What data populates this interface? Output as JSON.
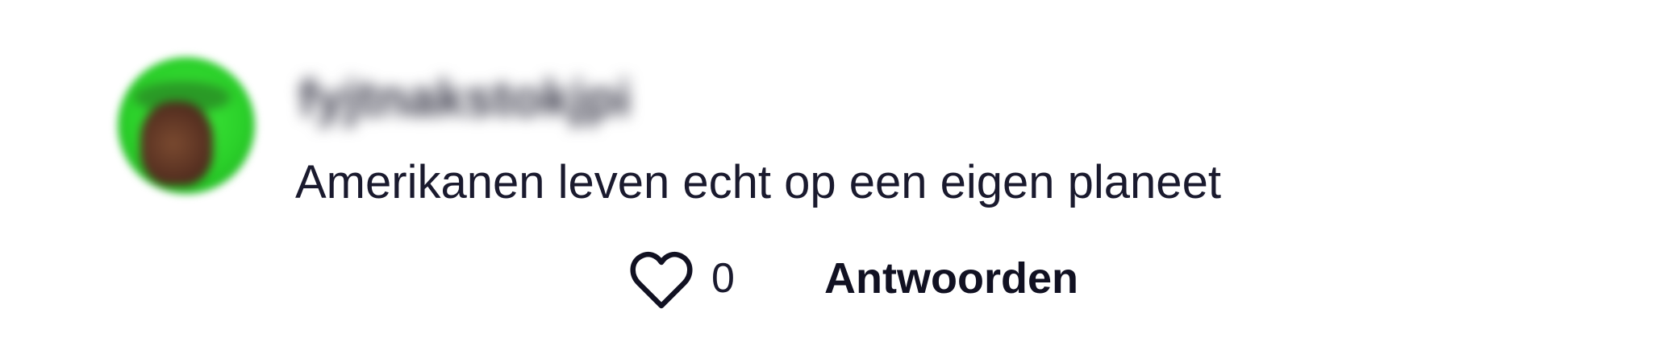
{
  "comment": {
    "avatar_icon": "user-avatar",
    "username": "fyjtnakstokjpi",
    "text": "Amerikanen leven echt op een eigen planeet",
    "likes": {
      "icon": "heart-icon",
      "count": "0"
    },
    "reply_label": "Antwoorden"
  },
  "colors": {
    "text": "#1a1a2e",
    "avatar_ring": "#2bd12a"
  }
}
